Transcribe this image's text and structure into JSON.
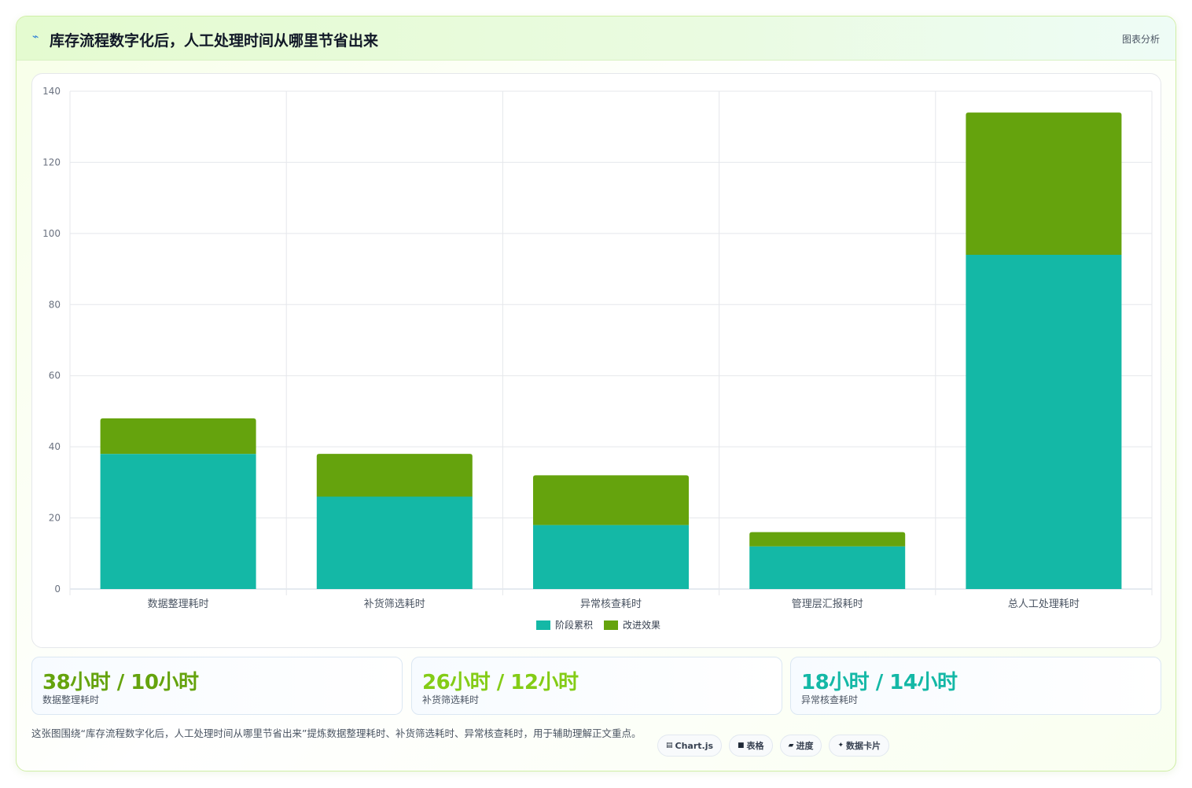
{
  "header": {
    "title": "库存流程数字化后，人工处理时间从哪里节省出来",
    "tag": "图表分析"
  },
  "chart_data": {
    "type": "bar",
    "stacked": true,
    "categories": [
      "数据整理耗时",
      "补货筛选耗时",
      "异常核查耗时",
      "管理层汇报耗时",
      "总人工处理耗时"
    ],
    "series": [
      {
        "name": "阶段累积",
        "values": [
          38,
          26,
          18,
          12,
          94
        ],
        "color": "#14b8a6"
      },
      {
        "name": "改进效果",
        "values": [
          10,
          12,
          14,
          4,
          40
        ],
        "color": "#65a30d"
      }
    ],
    "ylim": [
      0,
      140
    ],
    "yticks": [
      0,
      20,
      40,
      60,
      80,
      100,
      120,
      140
    ],
    "grid": true,
    "legend": "bottom"
  },
  "stats": [
    {
      "value": "38小时 / 10小时",
      "label": "数据整理耗时",
      "color": "#65a30d"
    },
    {
      "value": "26小时 / 12小时",
      "label": "补货筛选耗时",
      "color": "#84cc16"
    },
    {
      "value": "18小时 / 14小时",
      "label": "异常核查耗时",
      "color": "#14b8a6"
    }
  ],
  "footer": {
    "text": "这张图围绕“库存流程数字化后，人工处理时间从哪里节省出来”提炼数据整理耗时、补货筛选耗时、异常核查耗时，用于辅助理解正文重点。",
    "chips": [
      {
        "icon": "chart-icon",
        "glyph": "▤",
        "label": "Chart.js"
      },
      {
        "icon": "table-icon",
        "glyph": "■",
        "label": "表格"
      },
      {
        "icon": "progress-icon",
        "glyph": "▰",
        "label": "进度"
      },
      {
        "icon": "sparkle-icon",
        "glyph": "✦",
        "label": "数据卡片"
      }
    ]
  }
}
